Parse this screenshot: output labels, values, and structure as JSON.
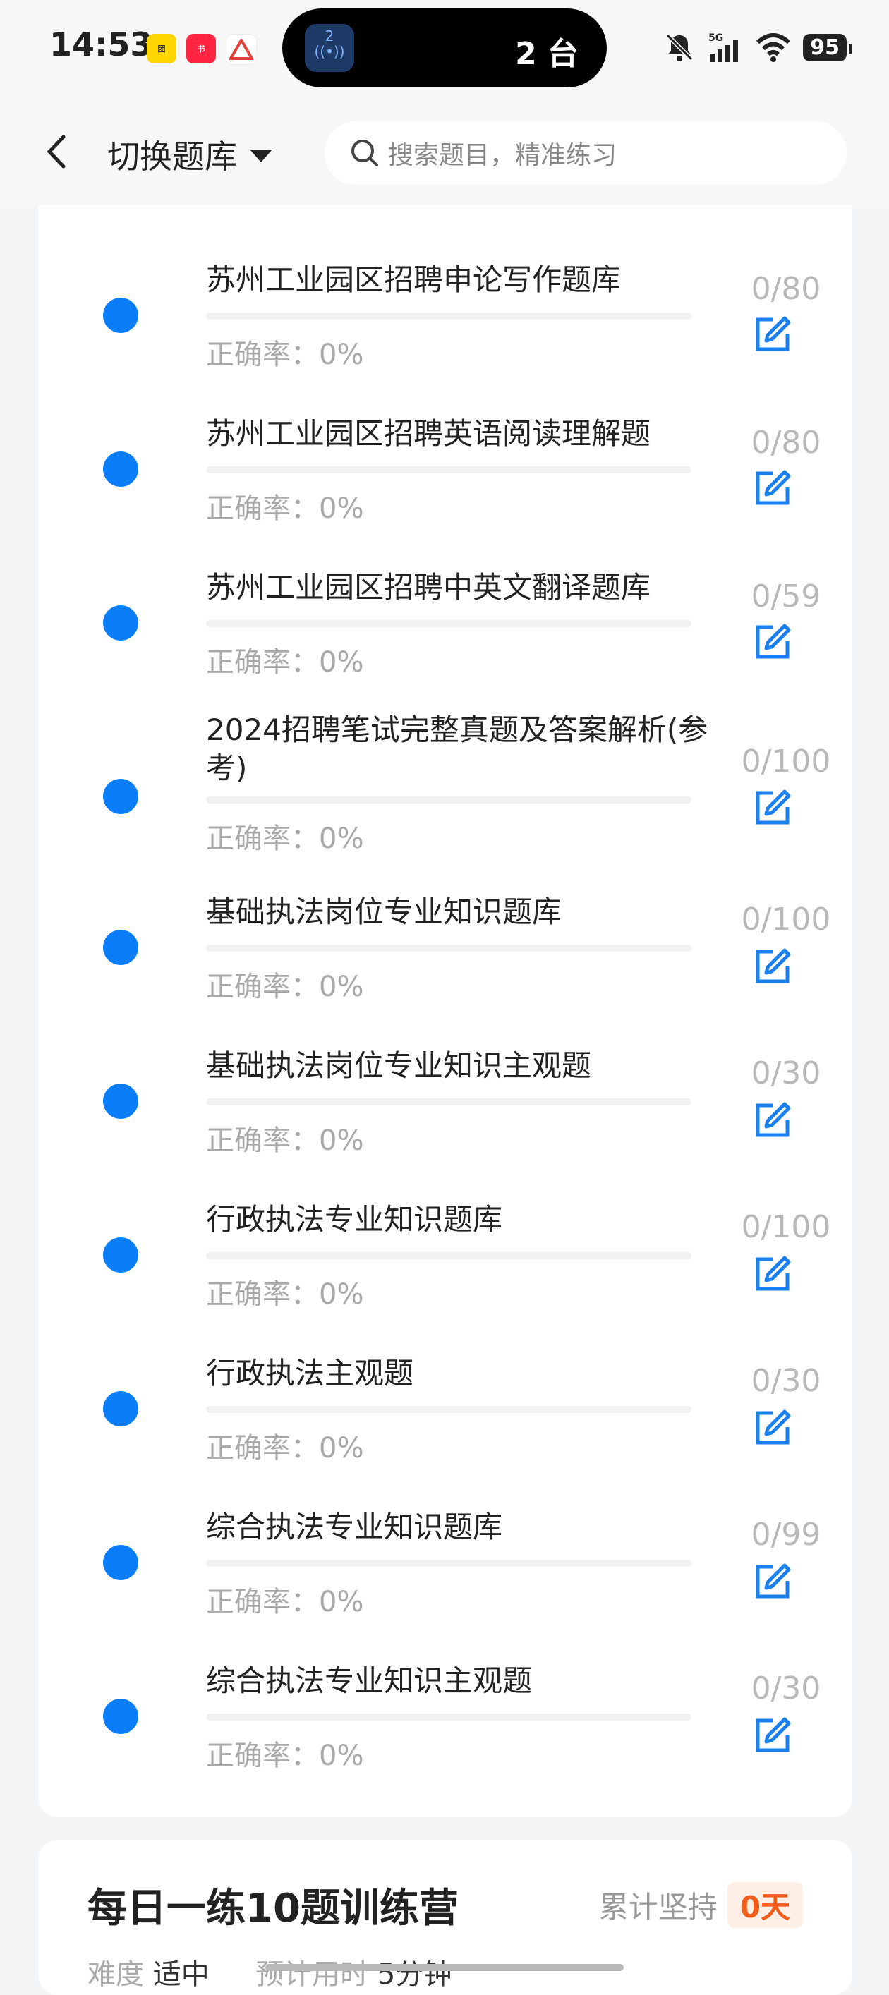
{
  "status_bar": {
    "time": "14:53",
    "island_text": "2 台",
    "island_badge": "2",
    "battery": "95",
    "network": "5G"
  },
  "header": {
    "title": "切换题库",
    "search_placeholder": "搜索题目，精准练习"
  },
  "accuracy_label": "正确率：0%",
  "items": [
    {
      "title": "苏州工业园区招聘申论写作题库",
      "count": "0/80"
    },
    {
      "title": "苏州工业园区招聘英语阅读理解题",
      "count": "0/80"
    },
    {
      "title": "苏州工业园区招聘中英文翻译题库",
      "count": "0/59"
    },
    {
      "title": "2024招聘笔试完整真题及答案解析(参考)",
      "count": "0/100"
    },
    {
      "title": "基础执法岗位专业知识题库",
      "count": "0/100"
    },
    {
      "title": "基础执法岗位专业知识主观题",
      "count": "0/30"
    },
    {
      "title": "行政执法专业知识题库",
      "count": "0/100"
    },
    {
      "title": "行政执法主观题",
      "count": "0/30"
    },
    {
      "title": "综合执法专业知识题库",
      "count": "0/99"
    },
    {
      "title": "综合执法专业知识主观题",
      "count": "0/30"
    }
  ],
  "daily": {
    "title": "每日一练10题训练营",
    "streak_label": "累计坚持",
    "streak_value": "0天",
    "difficulty_label": "难度",
    "difficulty_value": "适中",
    "time_label": "预计用时",
    "time_value": "5分钟"
  },
  "colors": {
    "accent": "#0a7ef8",
    "streak": "#f25c19"
  }
}
